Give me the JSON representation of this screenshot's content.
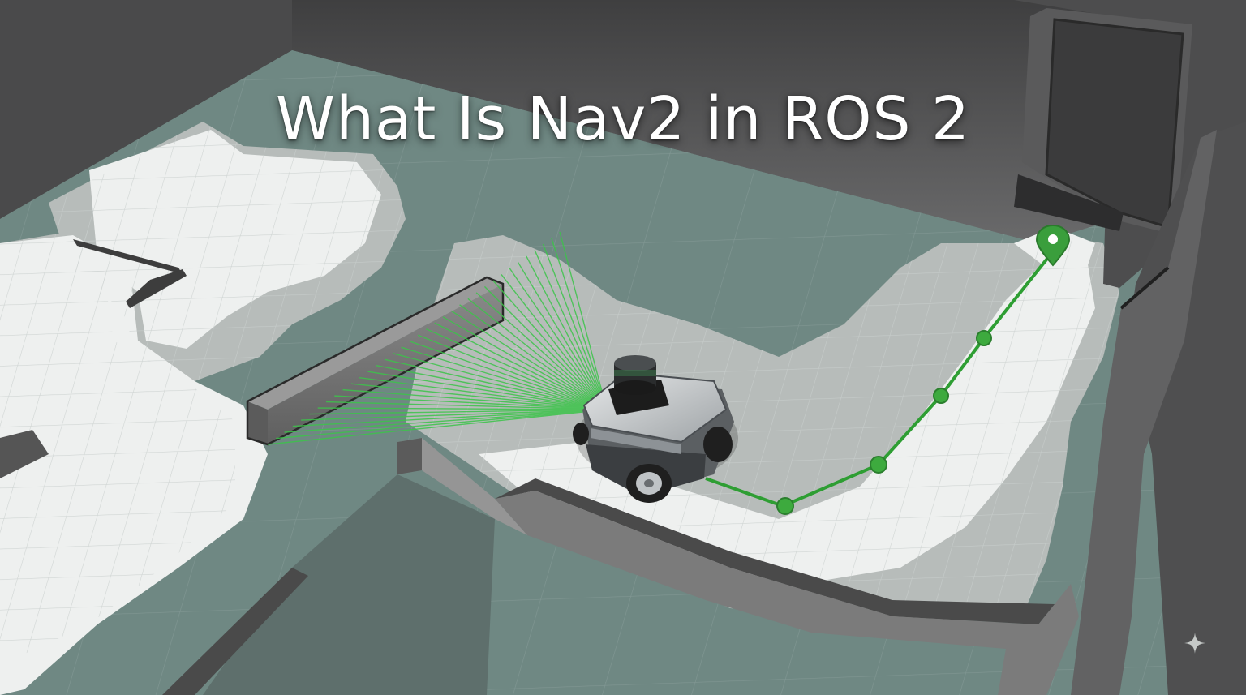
{
  "title": "What Is Nav2 in ROS 2",
  "colors": {
    "floor": "#6f8883",
    "free_space": "#eef0ef",
    "costmap_inflation": "#b7bcba",
    "wall": "#6e6e6e",
    "laser": "#3cc44a",
    "path": "#2e9e33",
    "goal_marker": "#3a9e3c"
  },
  "icons": [
    "robot",
    "lidar-sensor",
    "goal-pin-icon",
    "waypoint-icon",
    "sparkle-icon"
  ]
}
